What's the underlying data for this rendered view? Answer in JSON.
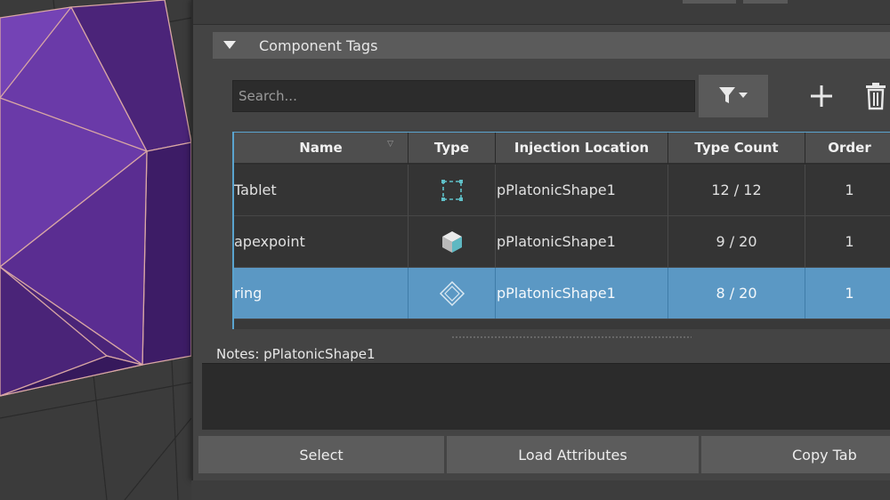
{
  "colors": {
    "accent": "#5b98c4",
    "panel": "#444444",
    "header": "#5b5b5b",
    "mesh": "#5a2d91"
  },
  "section": {
    "title": "Component Tags"
  },
  "search": {
    "placeholder": "Search..."
  },
  "toolbar": {
    "filter_icon": "filter-icon",
    "add_icon": "plus-icon",
    "delete_icon": "trash-icon"
  },
  "table": {
    "columns": [
      "Name",
      "Type",
      "Injection Location",
      "Type Count",
      "Order"
    ],
    "rows": [
      {
        "name": "Tablet",
        "type_icon": "face-component-icon",
        "location": "pPlatonicShape1",
        "count": "12 / 12",
        "order": "1",
        "selected": false
      },
      {
        "name": "apexpoint",
        "type_icon": "vertex-cube-icon",
        "location": "pPlatonicShape1",
        "count": "9 / 20",
        "order": "1",
        "selected": false
      },
      {
        "name": "ring",
        "type_icon": "edge-diamond-icon",
        "location": "pPlatonicShape1",
        "count": "8 / 20",
        "order": "1",
        "selected": true
      }
    ]
  },
  "notes": {
    "label": "Notes:  pPlatonicShape1"
  },
  "footer": {
    "select_label": "Select",
    "load_label": "Load Attributes",
    "copy_label": "Copy Tab"
  }
}
